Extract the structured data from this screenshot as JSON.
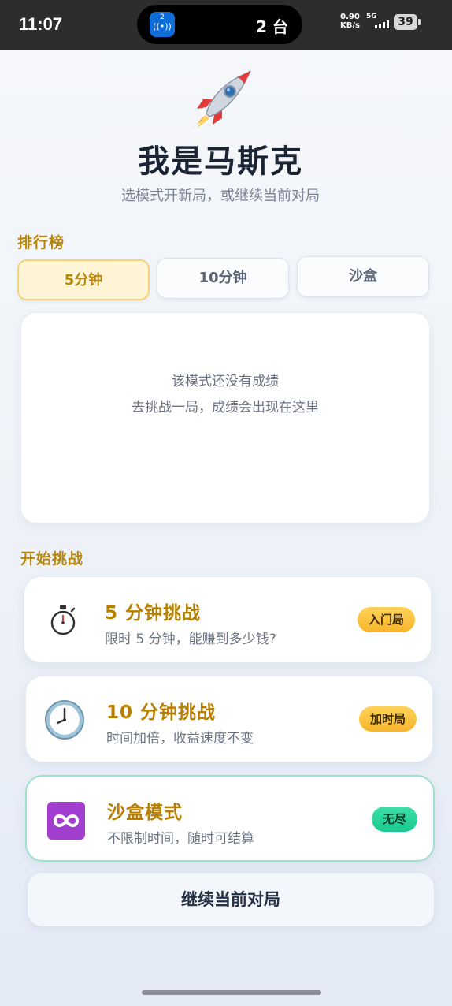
{
  "status_bar": {
    "time": "11:07",
    "island_app_digit": "2",
    "island_text": "2 台",
    "net_speed": "0.90",
    "net_unit": "KB/s",
    "signal": "5G",
    "battery": "39"
  },
  "header": {
    "icon": "rocket-icon",
    "title": "我是马斯克",
    "subtitle": "选模式开新局，或继续当前对局"
  },
  "leaderboard": {
    "label": "排行榜",
    "tabs": [
      {
        "label": "5分钟",
        "active": true
      },
      {
        "label": "10分钟",
        "active": false
      },
      {
        "label": "沙盒",
        "active": false
      }
    ],
    "empty_line1": "该模式还没有成绩",
    "empty_line2": "去挑战一局，成绩会出现在这里"
  },
  "challenges": {
    "label": "开始挑战",
    "items": [
      {
        "icon": "stopwatch-icon",
        "title": "5 分钟挑战",
        "desc": "限时 5 分钟，能赚到多少钱?",
        "badge": "入门局",
        "badge_color": "#f7b32b"
      },
      {
        "icon": "clock-icon",
        "title": "10 分钟挑战",
        "desc": "时间加倍，收益速度不变",
        "badge": "加时局",
        "badge_color": "#f7b32b"
      },
      {
        "icon": "infinity-icon",
        "title": "沙盒模式",
        "desc": "不限制时间，随时可结算",
        "badge": "无尽",
        "badge_color": "#18c98e"
      }
    ]
  },
  "continue_button": "继续当前对局"
}
